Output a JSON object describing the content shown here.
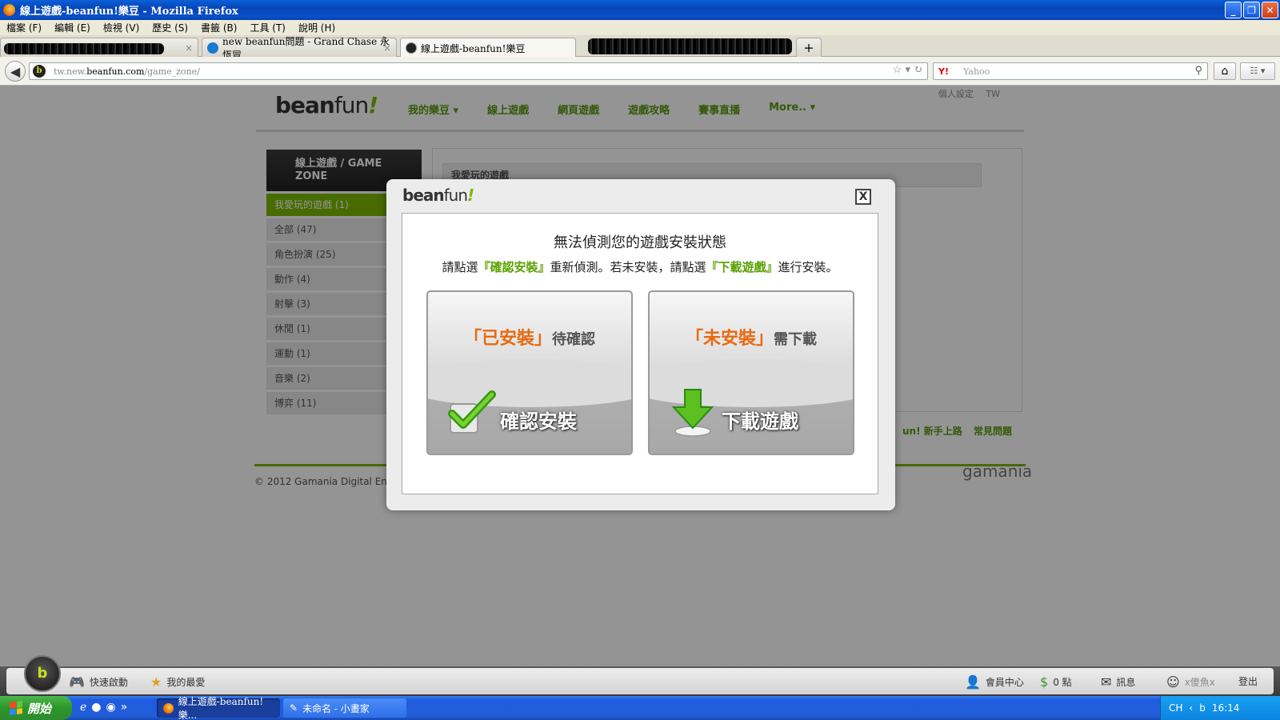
{
  "window": {
    "title": "線上遊戲-beanfun!樂豆 - Mozilla Firefox"
  },
  "menu": [
    "檔案 (F)",
    "編輯 (E)",
    "檢視 (V)",
    "歷史 (S)",
    "書籤 (B)",
    "工具 (T)",
    "說明 (H)"
  ],
  "tabs": [
    {
      "label": "new beanfun問題 - Grand Chase 永恆冒…"
    },
    {
      "label": "線上遊戲-beanfun!樂豆"
    }
  ],
  "nav": {
    "url_prefix": "tw.new.",
    "url_domain": "beanfun.com",
    "url_path": "/game_zone/",
    "search_engine": "Y!",
    "search_placeholder": "Yahoo"
  },
  "site": {
    "logo_bean": "bean",
    "logo_fun": "fun",
    "logo_bang": "!",
    "nav_items": [
      "我的樂豆 ▾",
      "線上遊戲",
      "網頁遊戲",
      "遊戲攻略",
      "賽事直播",
      "More.. ▾"
    ],
    "top_links": [
      "個人設定",
      "TW"
    ],
    "sidebar_title": "線上遊戲 / GAME ZONE",
    "sidebar_items": [
      "我愛玩的遊戲 (1)",
      "全部 (47)",
      "角色扮演 (25)",
      "動作 (4)",
      "射擊 (3)",
      "休閒 (1)",
      "運動 (1)",
      "音樂 (2)",
      "博弈 (11)"
    ],
    "main_heading": "我愛玩的遊戲",
    "footer_links": [
      "un! 新手上路",
      "常見問題"
    ],
    "copyright": "© 2012 Gamania Digital Enter",
    "brand": "gamania"
  },
  "modal": {
    "title": "無法偵測您的遊戲安裝狀態",
    "sub_before": "請點選",
    "sub_link1": "『確認安裝』",
    "sub_mid": "重新偵測。若未安裝，請點選",
    "sub_link2": "『下載遊戲』",
    "sub_after": "進行安裝。",
    "left_top": "「已安裝」",
    "left_top_small": "待確認",
    "left_action": "確認安裝",
    "right_top": "「未安裝」",
    "right_top_small": "需下載",
    "right_action": "下載遊戲",
    "close": "X"
  },
  "appbar": {
    "quick_launch": "快速啟動",
    "favorites": "我的最愛",
    "member_center": "會員中心",
    "points": "0 點",
    "messages": "訊息",
    "user": "x傻魚x",
    "logout": "登出"
  },
  "taskbar": {
    "start": "開始",
    "tasks": [
      "線上遊戲-beanfun!樂...",
      "未命名 - 小畫家"
    ],
    "lang": "CH",
    "time": "16:14"
  },
  "colors": {
    "brand_green": "#7ab800",
    "orange": "#e86a10",
    "xp_blue": "#225ed8"
  }
}
